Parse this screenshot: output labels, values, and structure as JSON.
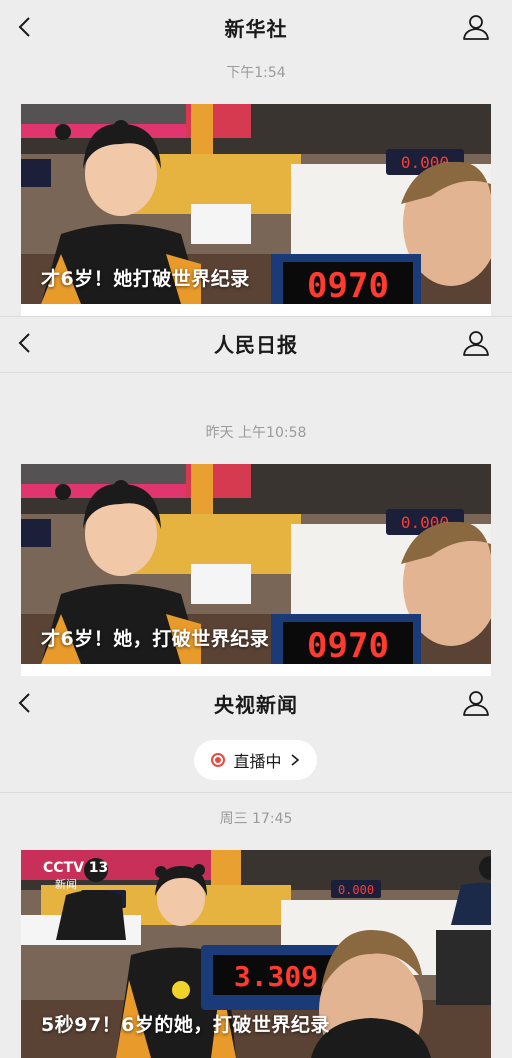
{
  "panels": [
    {
      "title": "新华社",
      "timestamp": "下午1:54",
      "caption": "才6岁！她打破世界纪录",
      "timer": "0970",
      "timer_small": "0.000"
    },
    {
      "title": "人民日报",
      "timestamp": "昨天 上午10:58",
      "caption": "才6岁！她，打破世界纪录",
      "timer": "0970",
      "timer_small": "0.000"
    },
    {
      "title": "央视新闻",
      "live_label": "直播中",
      "live_chevron": "›",
      "timestamp": "周三 17:45",
      "caption": "5秒97！6岁的她，打破世界纪录",
      "timer": "3.309",
      "timer_small": "0.000",
      "logo_text": "CCTV 13",
      "logo_sub": "新闻"
    }
  ],
  "icons": {
    "back": "chevron-left-icon",
    "profile": "user-profile-icon",
    "live": "live-dot-icon"
  },
  "colors": {
    "background": "#ededed",
    "live_red": "#e84b3c",
    "timer_red": "#ff3b30"
  }
}
